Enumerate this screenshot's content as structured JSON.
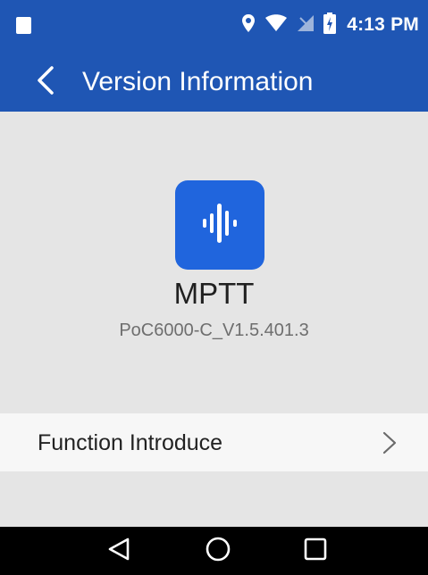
{
  "status_bar": {
    "time": "4:13 PM",
    "icons": [
      "notification-square-icon",
      "location-icon",
      "wifi-icon",
      "no-sim-icon",
      "battery-charging-icon"
    ]
  },
  "header": {
    "back_icon": "chevron-left-icon",
    "title": "Version Information"
  },
  "app_info": {
    "icon": "audio-waveform-icon",
    "name": "MPTT",
    "version": "PoC6000-C_V1.5.401.3"
  },
  "menu": {
    "items": [
      {
        "label": "Function Introduce",
        "icon": "chevron-right-icon"
      }
    ]
  },
  "nav_bar": {
    "buttons": [
      "back-triangle-icon",
      "home-circle-icon",
      "recents-square-icon"
    ]
  },
  "colors": {
    "primary": "#1f56b4",
    "app_icon_bg": "#2065dd",
    "content_bg": "#e5e5e5",
    "list_bg": "#f7f7f7",
    "nav_bg": "#000000"
  }
}
